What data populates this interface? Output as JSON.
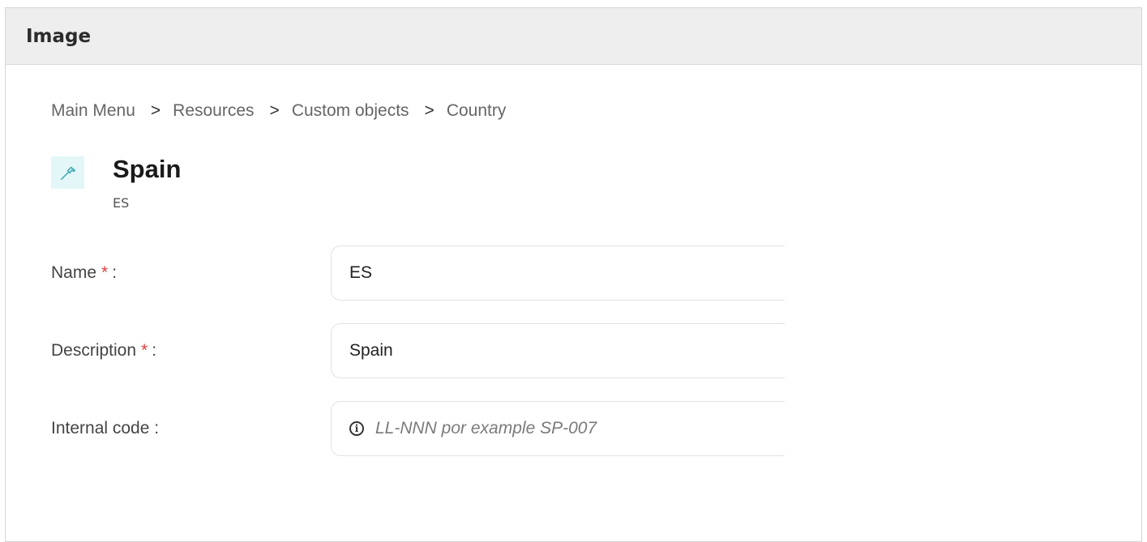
{
  "panel": {
    "title": "Image"
  },
  "breadcrumb": {
    "items": [
      "Main Menu",
      "Resources",
      "Custom objects",
      "Country"
    ],
    "separator": ">"
  },
  "record": {
    "icon": "hammer-icon",
    "title": "Spain",
    "code": "ES"
  },
  "form": {
    "name": {
      "label": "Name",
      "required_mark": "*",
      "colon": ":",
      "value": "ES"
    },
    "description": {
      "label": "Description",
      "required_mark": "*",
      "colon": ":",
      "value": "Spain"
    },
    "internal_code": {
      "label": "Internal code :",
      "placeholder": "LL-NNN por example SP-007",
      "icon": "info-icon"
    }
  },
  "colors": {
    "required": "#e03c3c",
    "icon_bg": "#e3f7f8",
    "icon_stroke": "#3aa6b0",
    "header_bg": "#eeeeee"
  }
}
